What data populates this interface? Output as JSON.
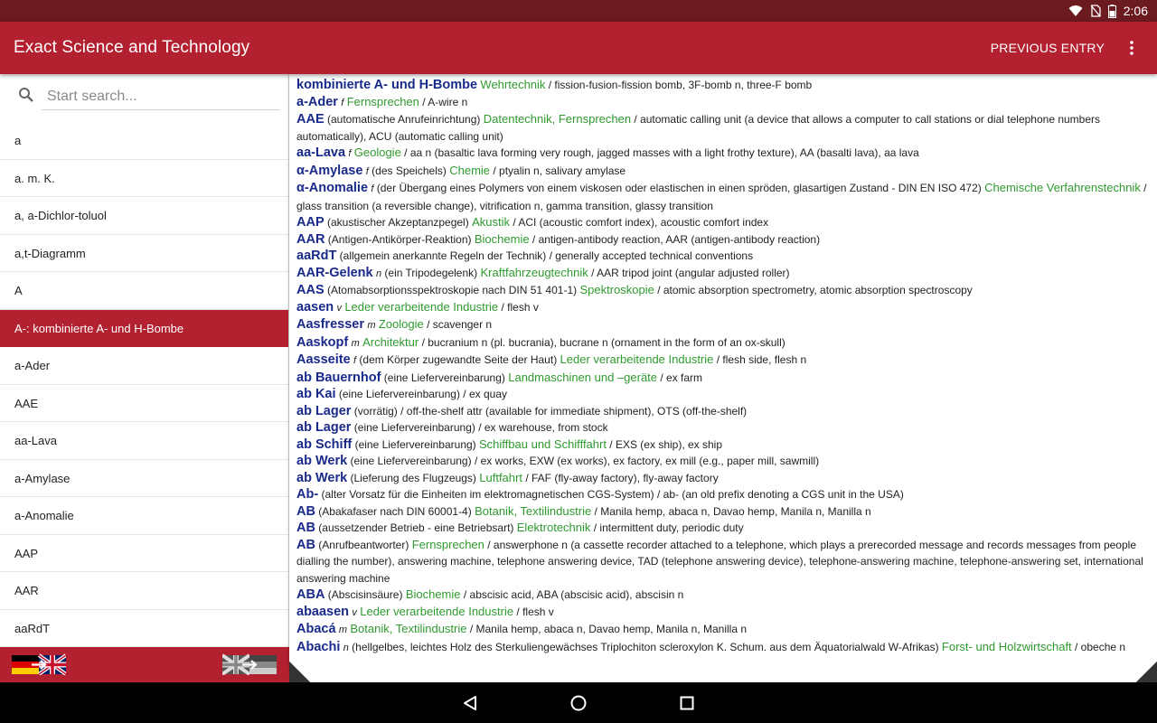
{
  "status_bar": {
    "time": "2:06"
  },
  "app_bar": {
    "title": "Exact Science and Technology",
    "previous_entry": "PREVIOUS ENTRY"
  },
  "search": {
    "placeholder": "Start search..."
  },
  "word_list": [
    {
      "label": "a",
      "selected": false
    },
    {
      "label": "a. m. K.",
      "selected": false
    },
    {
      "label": "a, a-Dichlor-toluol",
      "selected": false
    },
    {
      "label": "a,t-Diagramm",
      "selected": false
    },
    {
      "label": "A",
      "selected": false
    },
    {
      "label": "A-: kombinierte A- und H-Bombe",
      "selected": true
    },
    {
      "label": "a-Ader",
      "selected": false
    },
    {
      "label": "AAE",
      "selected": false
    },
    {
      "label": "aa-Lava",
      "selected": false
    },
    {
      "label": "a-Amylase",
      "selected": false
    },
    {
      "label": "a-Anomalie",
      "selected": false
    },
    {
      "label": "AAP",
      "selected": false
    },
    {
      "label": "AAR",
      "selected": false
    },
    {
      "label": "aaRdT",
      "selected": false
    }
  ],
  "entries": [
    {
      "hw": "kombinierte A- und H-Bombe",
      "gen": "",
      "pre": "",
      "subj": "Wehrtechnik",
      "def": " / fission-fusion-fission bomb, 3F-bomb n, three-F bomb"
    },
    {
      "hw": "a-Ader",
      "gen": "f",
      "pre": "",
      "subj": "Fernsprechen",
      "def": " / A-wire n"
    },
    {
      "hw": "AAE",
      "gen": "",
      "pre": "(automatische Anrufeinrichtung)",
      "subj": "Datentechnik, Fernsprechen",
      "def": " / automatic calling unit (a device that allows a computer to call stations or dial telephone numbers automatically), ACU (automatic calling unit)"
    },
    {
      "hw": "aa-Lava",
      "gen": "f",
      "pre": "",
      "subj": "Geologie",
      "def": " / aa n (basaltic lava forming very rough, jagged masses with a light frothy texture), AA (basalti lava), aa lava"
    },
    {
      "hw": "α-Amylase",
      "gen": "f",
      "pre": "(des Speichels)",
      "subj": "Chemie",
      "def": " / ptyalin n, salivary amylase"
    },
    {
      "hw": "α-Anomalie",
      "gen": "f",
      "pre": "(der Übergang eines Polymers von einem viskosen oder elastischen in einen spröden, glasartigen Zustand - DIN EN ISO 472)",
      "subj": "Chemische Verfahrenstechnik",
      "def": " / glass transition (a reversible change), vitrification n, gamma transition, glassy transition"
    },
    {
      "hw": "AAP",
      "gen": "",
      "pre": "(akustischer Akzeptanzpegel)",
      "subj": "Akustik",
      "def": " / ACI (acoustic comfort index), acoustic comfort index"
    },
    {
      "hw": "AAR",
      "gen": "",
      "pre": "(Antigen-Antikörper-Reaktion)",
      "subj": "Biochemie",
      "def": " / antigen-antibody reaction, AAR (antigen-antibody reaction)"
    },
    {
      "hw": "aaRdT",
      "gen": "",
      "pre": "(allgemein anerkannte Regeln der Technik)",
      "subj": "",
      "def": " / generally accepted technical conventions"
    },
    {
      "hw": "AAR-Gelenk",
      "gen": "n",
      "pre": "(ein Tripodegelenk)",
      "subj": "Kraftfahrzeugtechnik",
      "def": " / AAR tripod joint (angular adjusted roller)"
    },
    {
      "hw": "AAS",
      "gen": "",
      "pre": "(Atomabsorptionsspektroskopie nach DIN 51 401-1)",
      "subj": "Spektroskopie",
      "def": " / atomic absorption spectrometry, atomic absorption spectroscopy"
    },
    {
      "hw": "aasen",
      "gen": "v",
      "pre": "",
      "subj": "Leder verarbeitende Industrie",
      "def": " / flesh v"
    },
    {
      "hw": "Aasfresser",
      "gen": "m",
      "pre": "",
      "subj": "Zoologie",
      "def": " / scavenger n"
    },
    {
      "hw": "Aaskopf",
      "gen": "m",
      "pre": "",
      "subj": "Architektur",
      "def": " / bucranium n (pl. bucrania), bucrane n (ornament in the form of an ox-skull)"
    },
    {
      "hw": "Aasseite",
      "gen": "f",
      "pre": "(dem Körper zugewandte Seite der Haut)",
      "subj": "Leder verarbeitende Industrie",
      "def": " / flesh side, flesh n"
    },
    {
      "hw": "ab Bauernhof",
      "gen": "",
      "pre": "(eine Liefervereinbarung)",
      "subj": "Landmaschinen und –geräte",
      "def": " / ex farm"
    },
    {
      "hw": "ab Kai",
      "gen": "",
      "pre": "(eine Liefervereinbarung)",
      "subj": "",
      "def": " / ex quay"
    },
    {
      "hw": "ab Lager",
      "gen": "",
      "pre": "(vorrätig)",
      "subj": "",
      "def": " / off-the-shelf attr (available for immediate shipment), OTS (off-the-shelf)"
    },
    {
      "hw": "ab Lager",
      "gen": "",
      "pre": "(eine Liefervereinbarung)",
      "subj": "",
      "def": " / ex warehouse, from stock"
    },
    {
      "hw": "ab Schiff",
      "gen": "",
      "pre": "(eine Liefervereinbarung)",
      "subj": "Schiffbau und Schifffahrt",
      "def": " / EXS (ex ship), ex ship"
    },
    {
      "hw": "ab Werk",
      "gen": "",
      "pre": "(eine Liefervereinbarung)",
      "subj": "",
      "def": " / ex works, EXW (ex works), ex factory, ex mill (e.g., paper mill, sawmill)"
    },
    {
      "hw": "ab Werk",
      "gen": "",
      "pre": "(Lieferung des Flugzeugs)",
      "subj": "Luftfahrt",
      "def": " / FAF (fly-away factory), fly-away factory"
    },
    {
      "hw": "Ab-",
      "gen": "",
      "pre": "(alter Vorsatz für die Einheiten im elektromagnetischen CGS-System)",
      "subj": "",
      "def": " / ab- (an old prefix denoting a CGS unit in the USA)"
    },
    {
      "hw": "AB",
      "gen": "",
      "pre": "(Abakafaser nach DIN 60001-4)",
      "subj": "Botanik, Textilindustrie",
      "def": " / Manila hemp, abaca n, Davao hemp, Manila n, Manilla n"
    },
    {
      "hw": "AB",
      "gen": "",
      "pre": "(aussetzender Betrieb - eine Betriebsart)",
      "subj": "Elektrotechnik",
      "def": " / intermittent duty, periodic duty"
    },
    {
      "hw": "AB",
      "gen": "",
      "pre": "(Anrufbeantworter)",
      "subj": "Fernsprechen",
      "def": " / answerphone n (a cassette recorder attached to a telephone, which plays a prerecorded message and records messages from people dialling the number), answering machine, telephone answering device, TAD (telephone answering device), telephone-answering machine, telephone-answering set, international answering machine"
    },
    {
      "hw": "ABA",
      "gen": "",
      "pre": "(Abscisinsäure)",
      "subj": "Biochemie",
      "def": " / abscisic acid, ABA (abscisic acid), abscisin n"
    },
    {
      "hw": "abaasen",
      "gen": "v",
      "pre": "",
      "subj": "Leder verarbeitende Industrie",
      "def": " / flesh v"
    },
    {
      "hw": "Abacá",
      "gen": "m",
      "pre": "",
      "subj": "Botanik, Textilindustrie",
      "def": " / Manila hemp, abaca n, Davao hemp, Manila n, Manilla n"
    },
    {
      "hw": "Abachi",
      "gen": "n",
      "pre": "(hellgelbes, leichtes Holz des Sterkuliengewächses Triplochiton scleroxylon K. Schum. aus dem Äquatorialwald W-Afrikas)",
      "subj": "Forst- und Holzwirtschaft",
      "def": " / obeche n"
    }
  ],
  "colors": {
    "status_bar": "#6b1a20",
    "app_bar": "#b3202f",
    "headword": "#1a2a8a",
    "subject": "#2f9a2f",
    "selected_row": "#b3202f"
  },
  "icons": [
    "wifi-icon",
    "no-sim-icon",
    "battery-icon",
    "overflow-menu-icon",
    "search-icon",
    "de-to-en-flag-icon",
    "en-to-de-flag-icon",
    "back-icon",
    "home-icon",
    "recents-icon"
  ]
}
